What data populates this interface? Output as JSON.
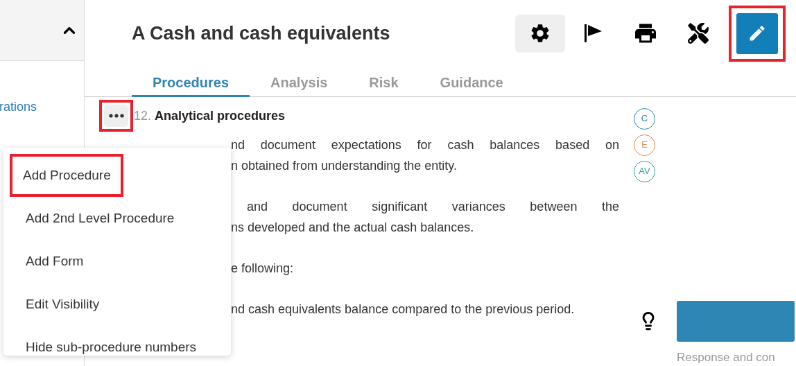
{
  "sidebar": {
    "links": [
      "rations"
    ]
  },
  "header": {
    "title": "A Cash and cash equivalents",
    "toolbar": [
      {
        "kind": "settings",
        "selected": true,
        "highlighted": false
      },
      {
        "kind": "flag",
        "selected": false,
        "highlighted": false
      },
      {
        "kind": "print",
        "selected": false,
        "highlighted": false
      },
      {
        "kind": "tools",
        "selected": false,
        "highlighted": false
      },
      {
        "kind": "edit",
        "selected": false,
        "highlighted": true
      }
    ]
  },
  "tabs": [
    {
      "label": "Procedures",
      "selected": true
    },
    {
      "label": "Analysis",
      "selected": false
    },
    {
      "label": "Risk",
      "selected": false
    },
    {
      "label": "Guidance",
      "selected": false
    }
  ],
  "procedure": {
    "more_button": {
      "highlighted": true
    },
    "number": "12.",
    "title": "Analytical procedures",
    "paragraphs": [
      [
        "nd document expectations for cash balances based on",
        "n obtained from understanding the entity."
      ],
      [
        "and document significant variances between the",
        "ns developed and the actual cash balances."
      ],
      [
        "e following:"
      ],
      [
        "nd cash equivalents balance compared to the previous period."
      ]
    ],
    "assertions": [
      {
        "label": "C",
        "color": "#2e86b5"
      },
      {
        "label": "E",
        "color": "#e08a47"
      },
      {
        "label": "AV",
        "color": "#2aa198"
      }
    ],
    "response_caption": "Response and con"
  },
  "menu": [
    {
      "label": "Add Procedure",
      "highlighted": true
    },
    {
      "label": "Add 2nd Level Procedure",
      "highlighted": false
    },
    {
      "label": "Add Form",
      "highlighted": false
    },
    {
      "label": "Edit Visibility",
      "highlighted": false
    },
    {
      "label": "Hide sub-procedure numbers",
      "highlighted": false
    }
  ]
}
